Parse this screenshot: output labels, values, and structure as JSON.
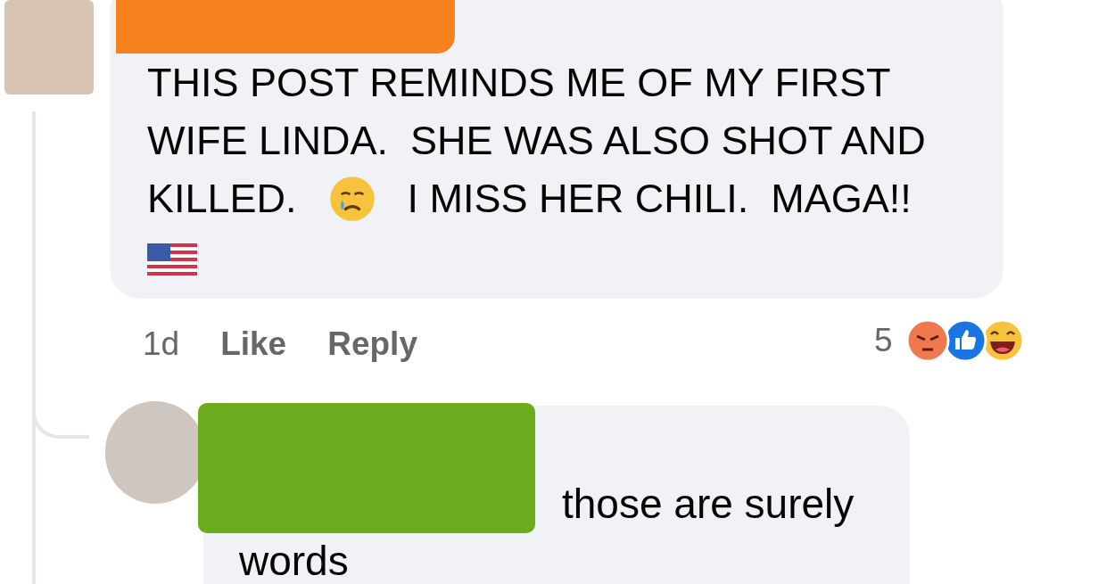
{
  "comments": [
    {
      "lines": [
        [
          {
            "kind": "text",
            "text": "THIS POST REMINDS ME OF MY FIRST"
          }
        ],
        [
          {
            "kind": "text",
            "text": "WIFE LINDA.  SHE WAS ALSO SHOT AND"
          }
        ],
        [
          {
            "kind": "text",
            "text": "KILLED."
          },
          {
            "kind": "crying_face"
          },
          {
            "kind": "text",
            "text": "I MISS HER CHILI.  MAGA!!"
          }
        ],
        [
          {
            "kind": "us_flag"
          }
        ]
      ],
      "time": "1d",
      "actions": [
        "Like",
        "Reply"
      ],
      "reaction_count": "5"
    },
    {
      "lines": [
        [
          {
            "kind": "text",
            "text": "those are surely words"
          }
        ]
      ]
    }
  ]
}
